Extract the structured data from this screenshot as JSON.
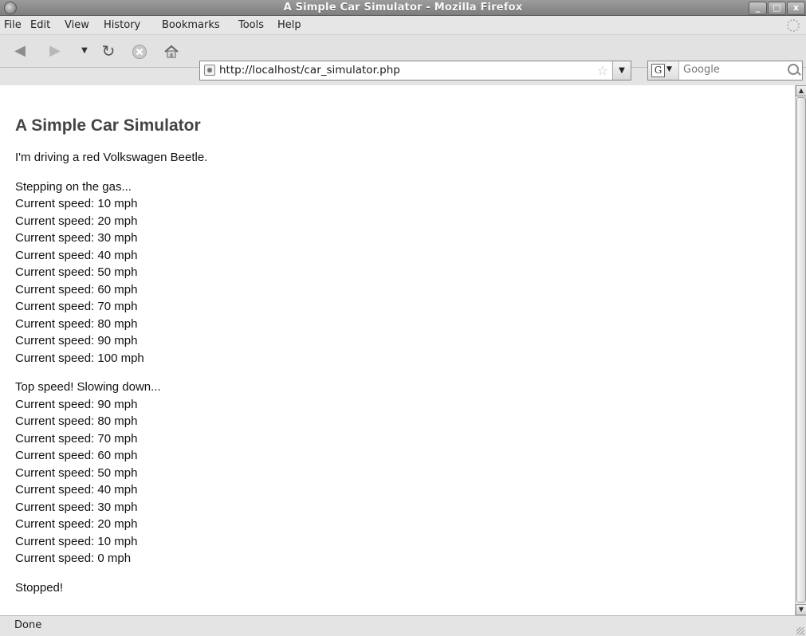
{
  "window": {
    "title": "A Simple Car Simulator - Mozilla Firefox",
    "controls": {
      "minimize": "_",
      "maximize": "□",
      "close": "x"
    }
  },
  "menu": {
    "items": [
      {
        "label": "File"
      },
      {
        "label": "Edit"
      },
      {
        "label": "View"
      },
      {
        "label": "History"
      },
      {
        "label": "Bookmarks"
      },
      {
        "label": "Tools"
      },
      {
        "label": "Help"
      }
    ]
  },
  "toolbar": {
    "icons": [
      "back-icon",
      "forward-icon",
      "history-dropdown-icon",
      "reload-icon",
      "stop-icon",
      "home-icon"
    ]
  },
  "address_bar": {
    "url": "http://localhost/car_simulator.php"
  },
  "search_bar": {
    "engine_letter": "G",
    "placeholder": "Google"
  },
  "page": {
    "heading": "A Simple Car Simulator",
    "intro": "I'm driving a red Volkswagen Beetle.",
    "accelerate": {
      "header": "Stepping on the gas...",
      "lines": [
        "Current speed: 10 mph",
        "Current speed: 20 mph",
        "Current speed: 30 mph",
        "Current speed: 40 mph",
        "Current speed: 50 mph",
        "Current speed: 60 mph",
        "Current speed: 70 mph",
        "Current speed: 80 mph",
        "Current speed: 90 mph",
        "Current speed: 100 mph"
      ]
    },
    "decelerate": {
      "header": "Top speed! Slowing down...",
      "lines": [
        "Current speed: 90 mph",
        "Current speed: 80 mph",
        "Current speed: 70 mph",
        "Current speed: 60 mph",
        "Current speed: 50 mph",
        "Current speed: 40 mph",
        "Current speed: 30 mph",
        "Current speed: 20 mph",
        "Current speed: 10 mph",
        "Current speed: 0 mph"
      ]
    },
    "footer": "Stopped!"
  },
  "status": {
    "text": "Done"
  }
}
